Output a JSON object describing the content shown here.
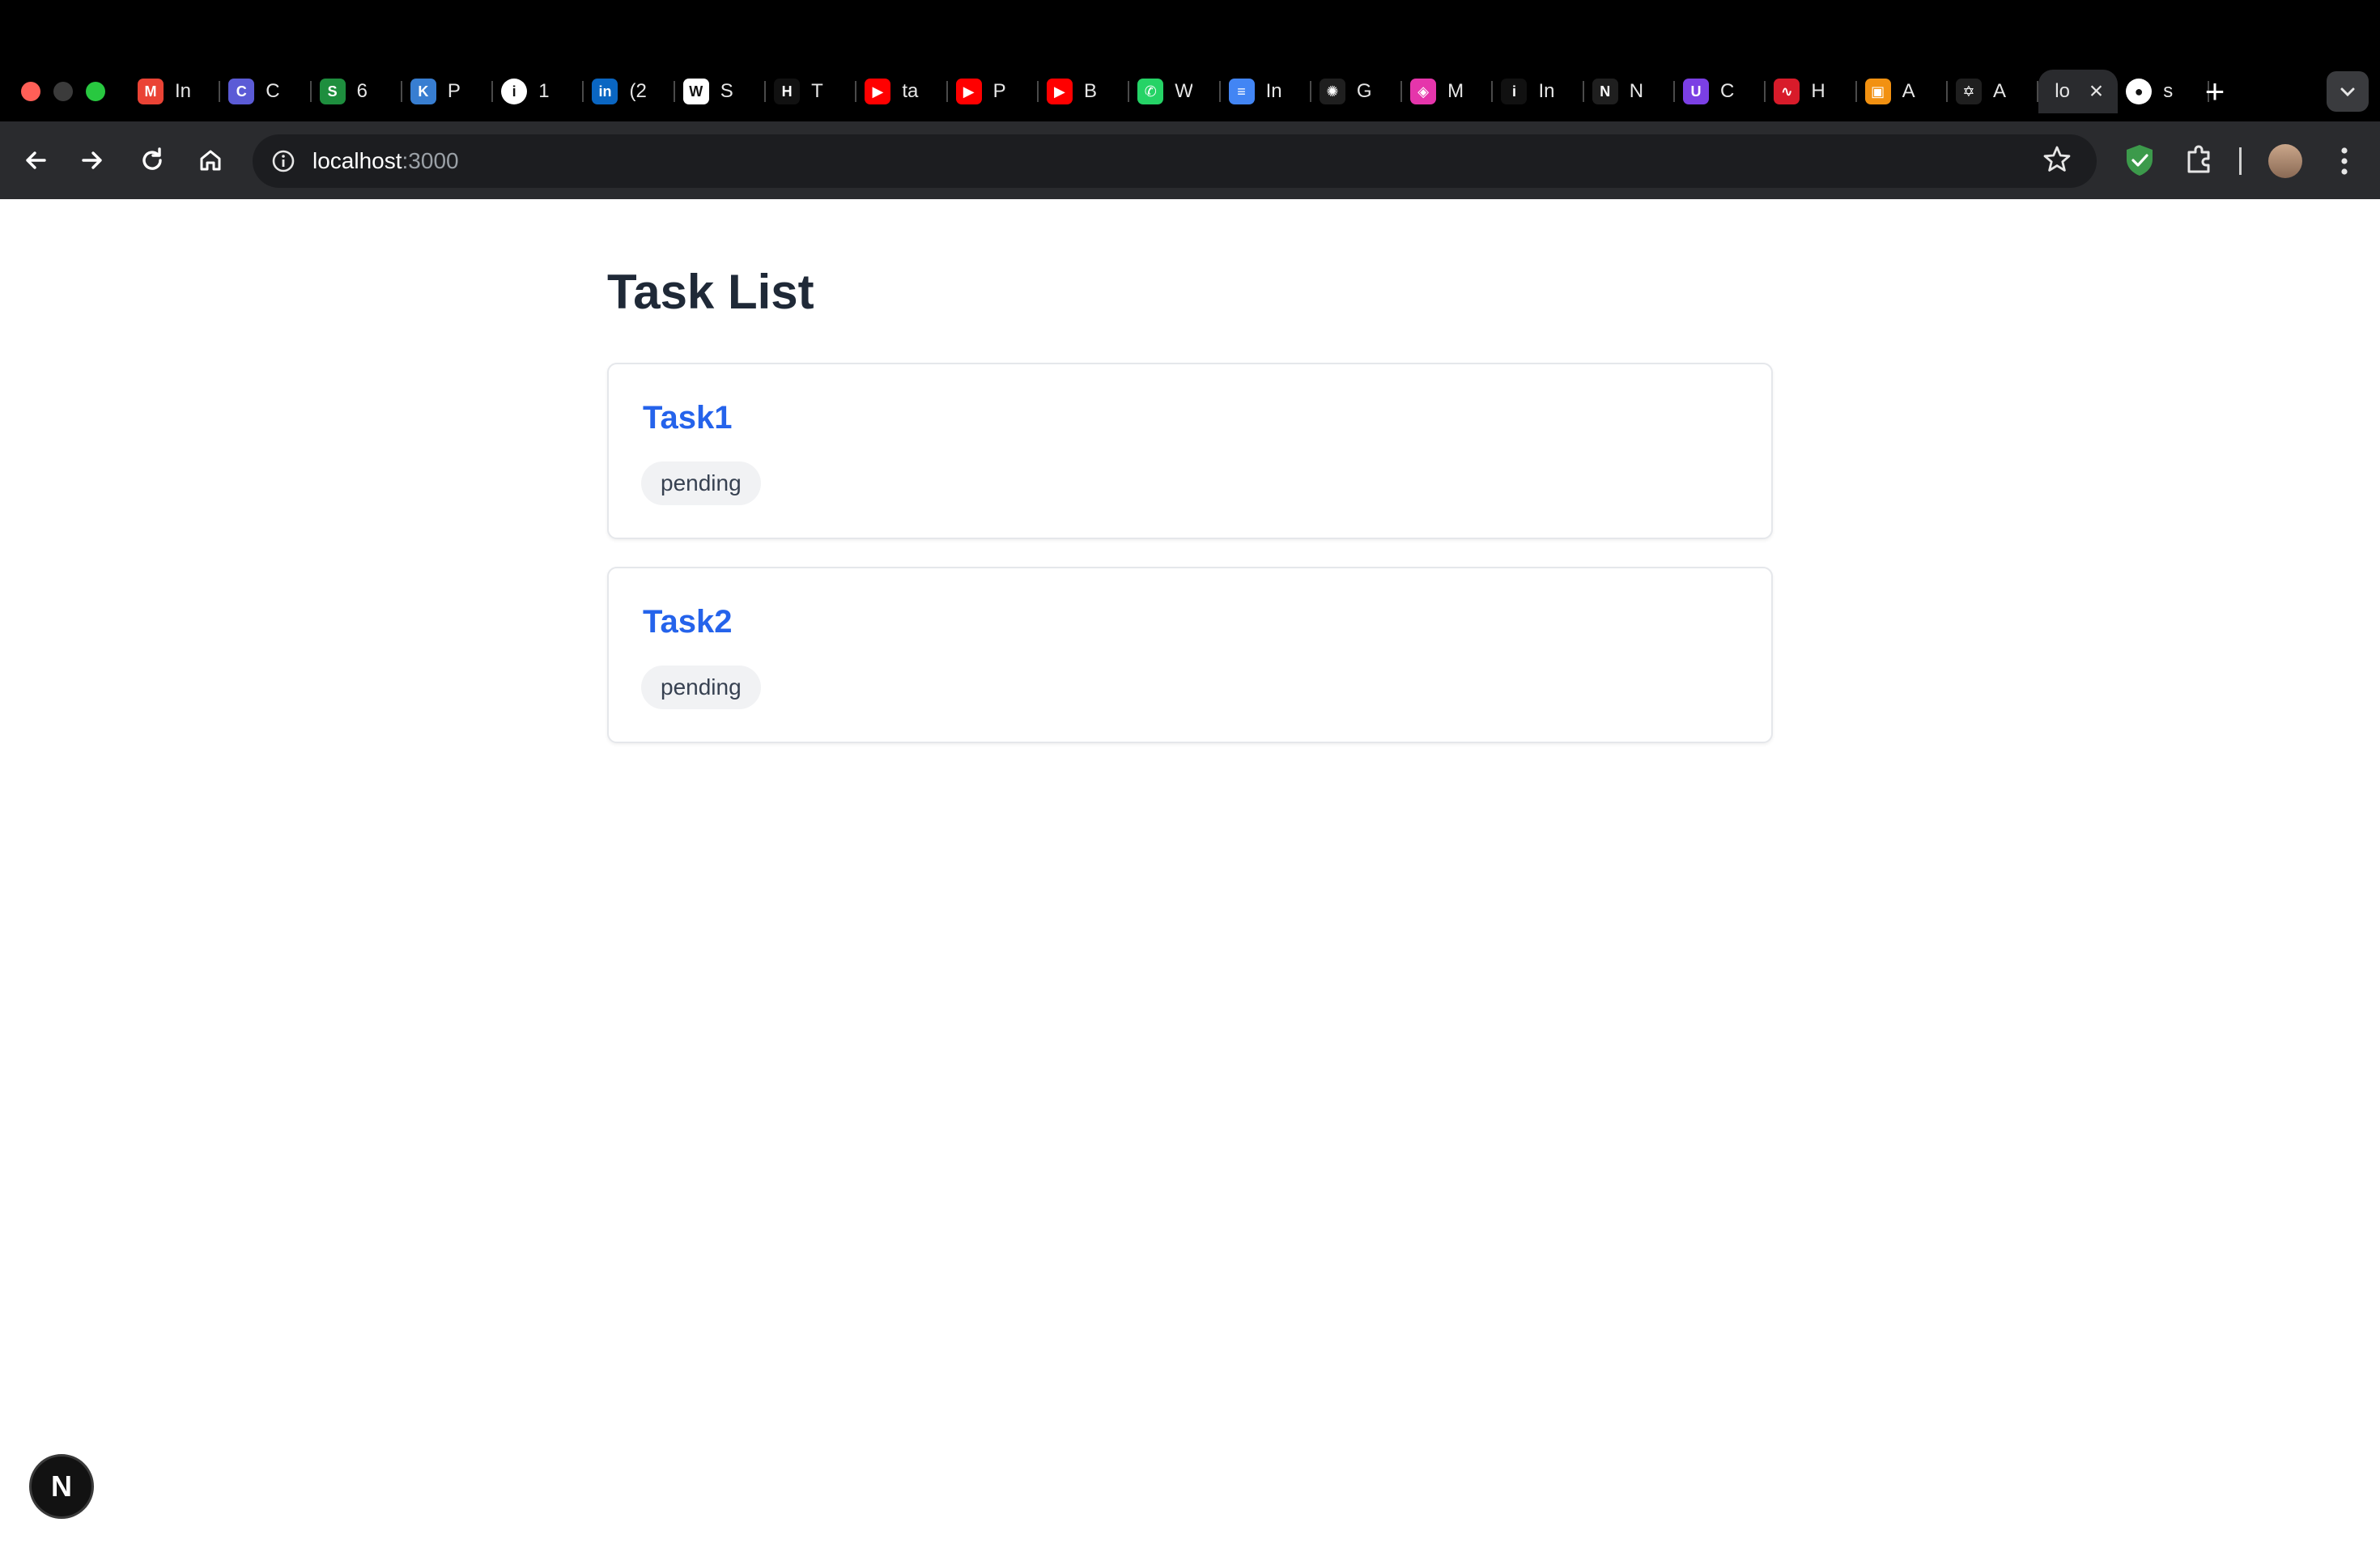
{
  "browser": {
    "tabs": [
      {
        "label": "In",
        "icon": "gmail-icon",
        "color": "#ea4335",
        "glyph": "M"
      },
      {
        "label": "C",
        "icon": "claude-icon",
        "color": "#5b5bd6",
        "glyph": "C"
      },
      {
        "label": "6",
        "icon": "sheets-icon",
        "color": "#1e8e3e",
        "glyph": "S"
      },
      {
        "label": "P",
        "icon": "kite-icon",
        "color": "#387ed1",
        "glyph": "K"
      },
      {
        "label": "1",
        "icon": "info-icon",
        "color": "#ffffff",
        "glyph": "i"
      },
      {
        "label": "(2",
        "icon": "linkedin-icon",
        "color": "#0a66c2",
        "glyph": "in"
      },
      {
        "label": "S",
        "icon": "wiki-icon",
        "color": "#ffffff",
        "glyph": "W"
      },
      {
        "label": "T",
        "icon": "hn-icon",
        "color": "#111111",
        "glyph": "H"
      },
      {
        "label": "ta",
        "icon": "youtube-icon",
        "color": "#ff0000",
        "glyph": "▶"
      },
      {
        "label": "P",
        "icon": "youtube-icon",
        "color": "#ff0000",
        "glyph": "▶"
      },
      {
        "label": "B",
        "icon": "youtube-icon",
        "color": "#ff0000",
        "glyph": "▶"
      },
      {
        "label": "W",
        "icon": "whatsapp-icon",
        "color": "#25d366",
        "glyph": "✆"
      },
      {
        "label": "In",
        "icon": "docs-icon",
        "color": "#4285f4",
        "glyph": "≡"
      },
      {
        "label": "G",
        "icon": "openai-icon",
        "color": "#1f1f1f",
        "glyph": "✺"
      },
      {
        "label": "M",
        "icon": "graphql-icon",
        "color": "#e535ab",
        "glyph": "◈"
      },
      {
        "label": "In",
        "icon": "indeed-icon",
        "color": "#111111",
        "glyph": "i"
      },
      {
        "label": "N",
        "icon": "nestjs-icon",
        "color": "#1f1f1f",
        "glyph": "N"
      },
      {
        "label": "C",
        "icon": "uphold-icon",
        "color": "#7b3fe4",
        "glyph": "U"
      },
      {
        "label": "H",
        "icon": "pulse-icon",
        "color": "#d81b2a",
        "glyph": "∿"
      },
      {
        "label": "A",
        "icon": "box-icon",
        "color": "#f29111",
        "glyph": "▣"
      },
      {
        "label": "A",
        "icon": "atom-icon",
        "color": "#1f1f1f",
        "glyph": "✡"
      },
      {
        "label": "lo",
        "icon": "",
        "color": "",
        "glyph": "",
        "active": true
      },
      {
        "label": "s",
        "icon": "github-icon",
        "color": "#ffffff",
        "glyph": "●"
      }
    ],
    "new_tab": "+",
    "url_host": "localhost",
    "url_port": ":3000"
  },
  "page": {
    "title": "Task List",
    "tasks": [
      {
        "name": "Task1",
        "status": "pending"
      },
      {
        "name": "Task2",
        "status": "pending"
      }
    ]
  },
  "nextjs_badge": "N"
}
